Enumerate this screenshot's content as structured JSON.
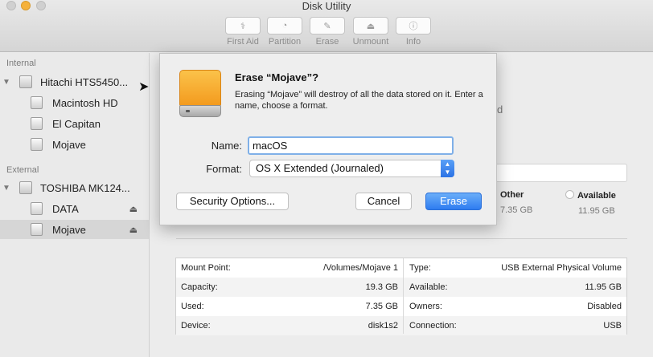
{
  "window": {
    "title": "Disk Utility"
  },
  "toolbar": {
    "items": [
      {
        "label": "First Aid",
        "icon": "stethoscope-icon",
        "glyph": "⚕"
      },
      {
        "label": "Partition",
        "icon": "partition-icon",
        "glyph": "◔"
      },
      {
        "label": "Erase",
        "icon": "erase-icon",
        "glyph": "✎"
      },
      {
        "label": "Unmount",
        "icon": "unmount-icon",
        "glyph": "⏏"
      },
      {
        "label": "Info",
        "icon": "info-icon",
        "glyph": "ⓘ"
      }
    ]
  },
  "sidebar": {
    "internal_label": "Internal",
    "external_label": "External",
    "internal_disk": "Hitachi HTS5450...",
    "internal_volumes": [
      "Macintosh HD",
      "El Capitan",
      "Mojave"
    ],
    "external_disk": "TOSHIBA MK124...",
    "external_volumes": [
      "DATA",
      "Mojave"
    ],
    "eject_glyph": "⏏"
  },
  "background": {
    "partial_text": "d",
    "legend": [
      {
        "name": "Other",
        "value": "7.35 GB"
      },
      {
        "name": "Available",
        "value": "11.95 GB"
      }
    ]
  },
  "info": {
    "left": [
      {
        "label": "Mount Point:",
        "value": "/Volumes/Mojave 1"
      },
      {
        "label": "Capacity:",
        "value": "19.3 GB"
      },
      {
        "label": "Used:",
        "value": "7.35 GB"
      },
      {
        "label": "Device:",
        "value": "disk1s2"
      }
    ],
    "right": [
      {
        "label": "Type:",
        "value": "USB External Physical Volume"
      },
      {
        "label": "Available:",
        "value": "11.95 GB"
      },
      {
        "label": "Owners:",
        "value": "Disabled"
      },
      {
        "label": "Connection:",
        "value": "USB"
      }
    ]
  },
  "dialog": {
    "title": "Erase “Mojave”?",
    "description": "Erasing “Mojave” will destroy of all the data stored on it. Enter a name, choose a format.",
    "name_label": "Name:",
    "name_value": "macOS",
    "format_label": "Format:",
    "format_value": "OS X Extended (Journaled)",
    "security_button": "Security Options...",
    "cancel_button": "Cancel",
    "erase_button": "Erase"
  }
}
